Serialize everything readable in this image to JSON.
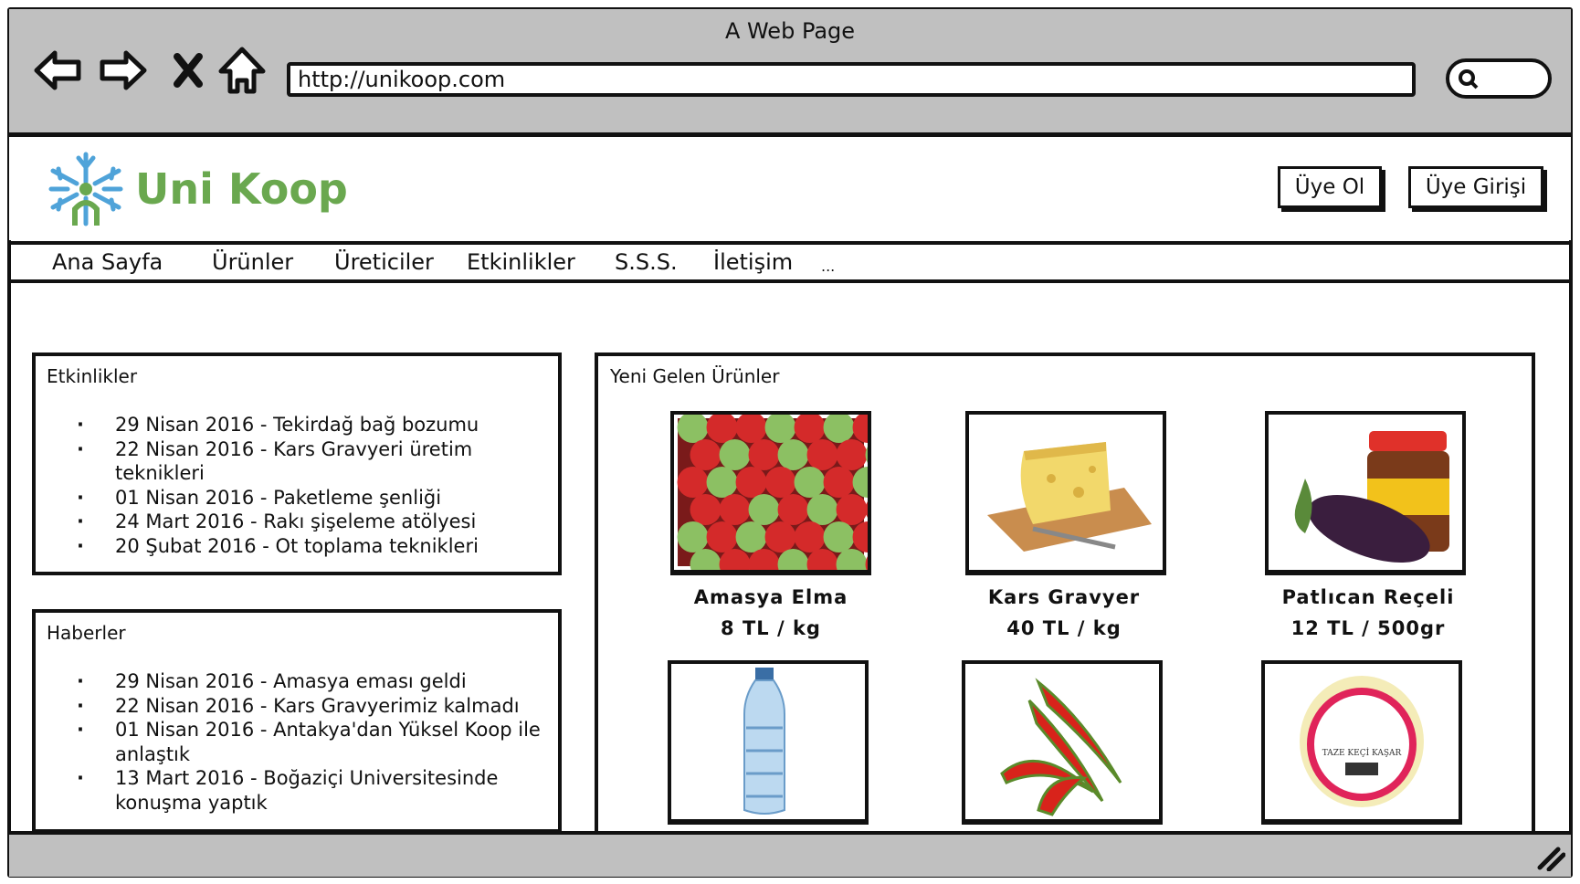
{
  "browser": {
    "title": "A Web Page",
    "url": "http://unikoop.com",
    "icons": [
      "back-arrow-icon",
      "forward-arrow-icon",
      "close-icon",
      "home-icon",
      "search-icon"
    ]
  },
  "header": {
    "logo_text": "Uni Koop",
    "brand_color": "#6aa84f",
    "logo_icon_color": "#4fa3d9",
    "signup_label": "Üye Ol",
    "login_label": "Üye Girişi"
  },
  "nav": {
    "items": [
      "Ana Sayfa",
      "Ürünler",
      "Üreticiler",
      "Etkinlikler",
      "S.S.S.",
      "İletişim",
      "..."
    ]
  },
  "events": {
    "title": "Etkinlikler",
    "items": [
      "29 Nisan 2016 - Tekirdağ bağ bozumu",
      "22 Nisan 2016 - Kars Gravyeri üretim teknikleri",
      "01 Nisan 2016 - Paketleme şenliği",
      "24 Mart 2016 - Rakı şişeleme atölyesi",
      "20 Şubat 2016 - Ot toplama teknikleri"
    ]
  },
  "news": {
    "title": "Haberler",
    "items": [
      "29 Nisan 2016 - Amasya eması geldi",
      "22 Nisan 2016 - Kars Gravyerimiz kalmadı",
      "01 Nisan 2016 - Antakya'dan Yüksel Koop ile",
      "anlaştık",
      "13 Mart 2016 - Boğaziçi Universitesinde",
      "konuşma yaptık"
    ]
  },
  "products": {
    "title": "Yeni Gelen Ürünler",
    "items": [
      {
        "name": "Amasya Elma",
        "price": "8 TL / kg",
        "image": "apples"
      },
      {
        "name": "Kars Gravyer",
        "price": "40 TL / kg",
        "image": "cheese"
      },
      {
        "name": "Patlıcan Reçeli",
        "price": "12 TL / 500gr",
        "image": "eggplant-jam"
      },
      {
        "image": "water-bottle"
      },
      {
        "image": "red-peppers"
      },
      {
        "image": "goat-kashar-cheese",
        "label_text": "TAZE KEÇİ KAŞAR"
      }
    ]
  }
}
